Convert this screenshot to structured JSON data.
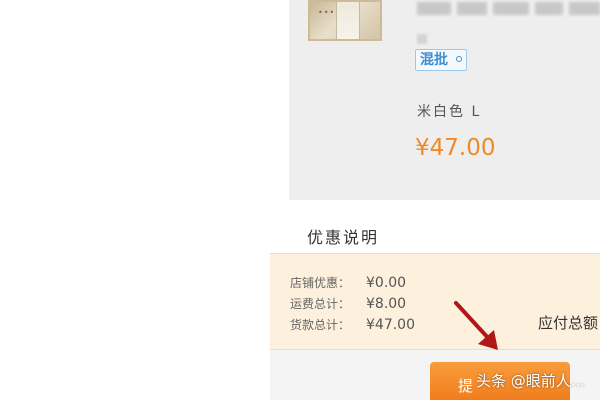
{
  "product": {
    "tag_label": "混批",
    "variant": "米白色 L",
    "price": "¥47.00"
  },
  "discount": {
    "heading": "优惠说明"
  },
  "summary": {
    "rows": [
      {
        "label": "店铺优惠：",
        "value": "¥0.00"
      },
      {
        "label": "运费总计：",
        "value": "¥8.00"
      },
      {
        "label": "货款总计：",
        "value": "¥47.00"
      }
    ],
    "total_label": "应付总额"
  },
  "footer": {
    "submit_label": "提"
  },
  "watermark": "头条 @眼前人..."
}
